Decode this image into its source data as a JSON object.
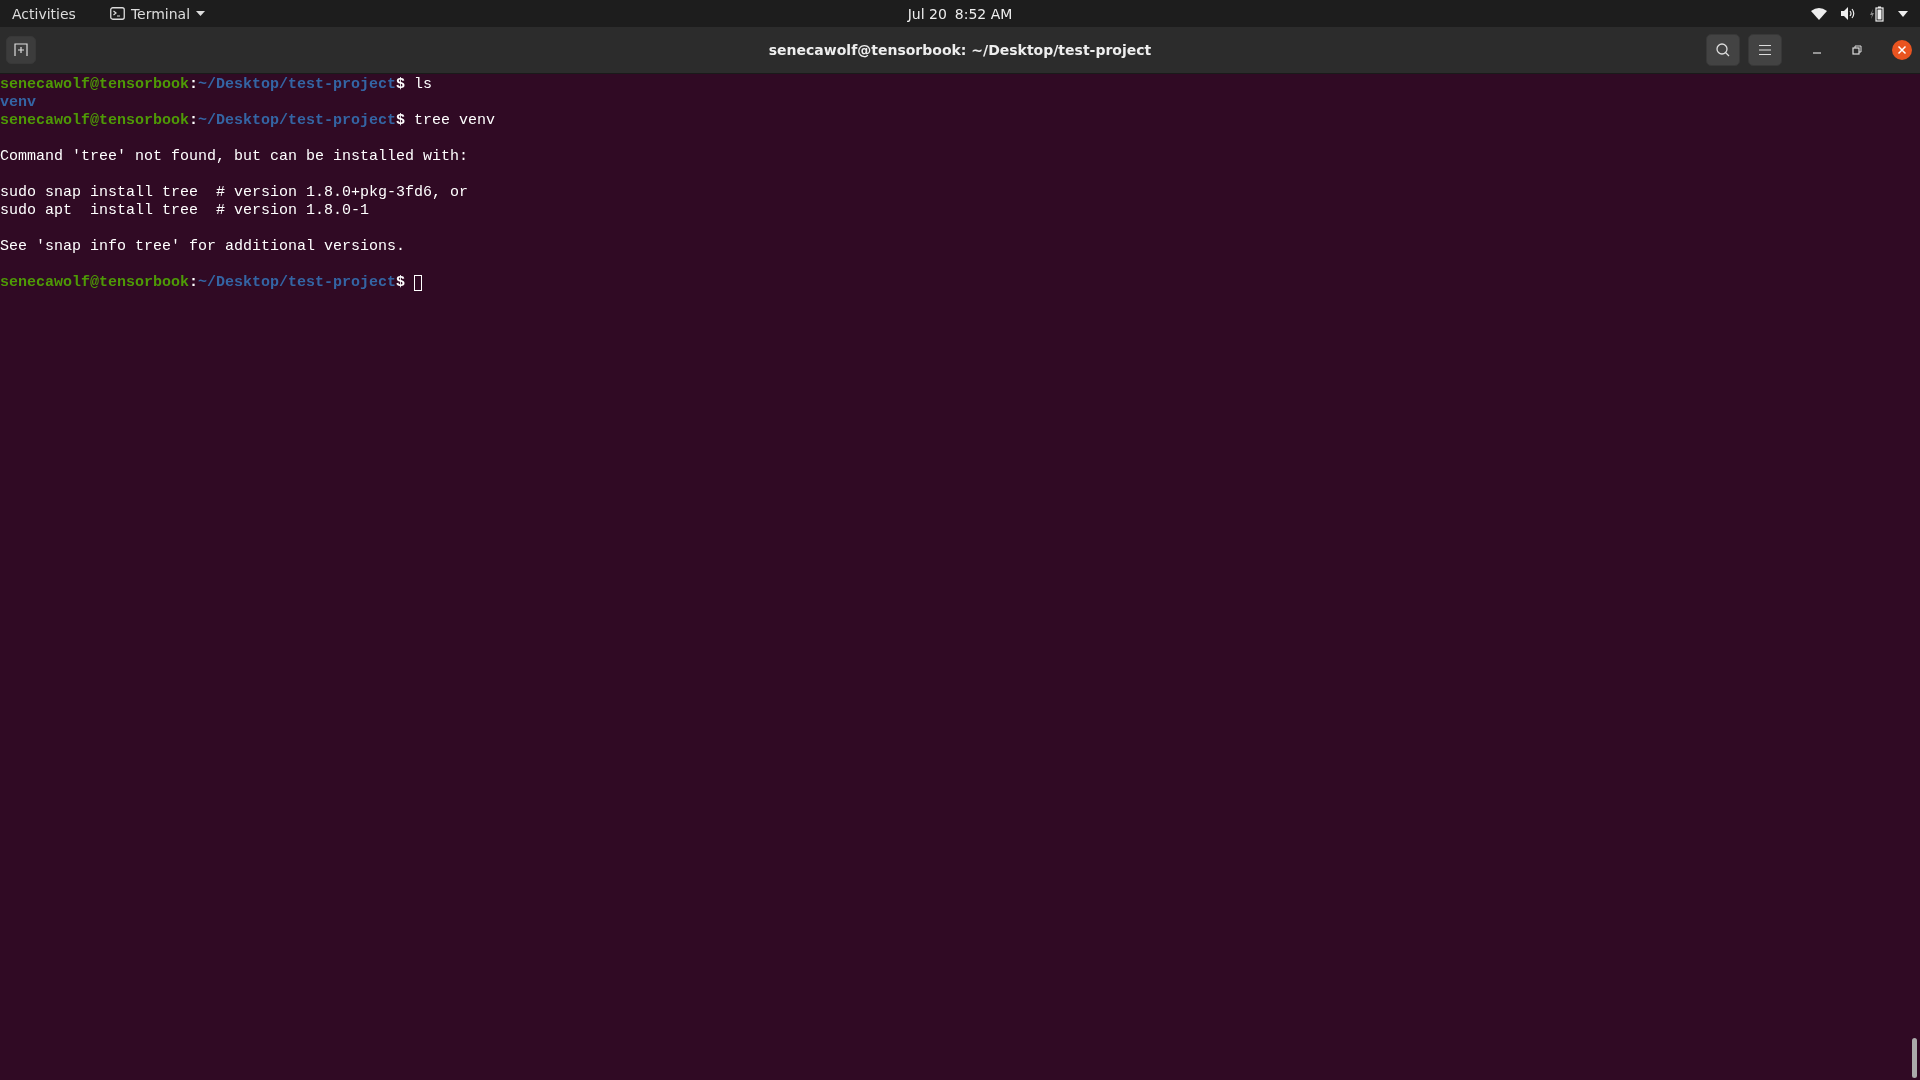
{
  "top_bar": {
    "activities": "Activities",
    "app_menu": "Terminal",
    "date": "Jul 20",
    "time": "8:52 AM"
  },
  "window": {
    "title": "senecawolf@tensorbook: ~/Desktop/test-project"
  },
  "terminal": {
    "lines": [
      {
        "kind": "prompt",
        "user": "senecawolf@tensorbook",
        "separator": ":",
        "path": "~/Desktop/test-project",
        "symbol": "$",
        "command": "ls",
        "cursor": false
      },
      {
        "kind": "dir",
        "text": "venv"
      },
      {
        "kind": "prompt",
        "user": "senecawolf@tensorbook",
        "separator": ":",
        "path": "~/Desktop/test-project",
        "symbol": "$",
        "command": "tree venv",
        "cursor": false
      },
      {
        "kind": "blank"
      },
      {
        "kind": "output",
        "text": "Command 'tree' not found, but can be installed with:"
      },
      {
        "kind": "blank"
      },
      {
        "kind": "output",
        "text": "sudo snap install tree  # version 1.8.0+pkg-3fd6, or"
      },
      {
        "kind": "output",
        "text": "sudo apt  install tree  # version 1.8.0-1"
      },
      {
        "kind": "blank"
      },
      {
        "kind": "output",
        "text": "See 'snap info tree' for additional versions."
      },
      {
        "kind": "blank"
      },
      {
        "kind": "prompt",
        "user": "senecawolf@tensorbook",
        "separator": ":",
        "path": "~/Desktop/test-project",
        "symbol": "$",
        "cursor": true
      }
    ]
  }
}
